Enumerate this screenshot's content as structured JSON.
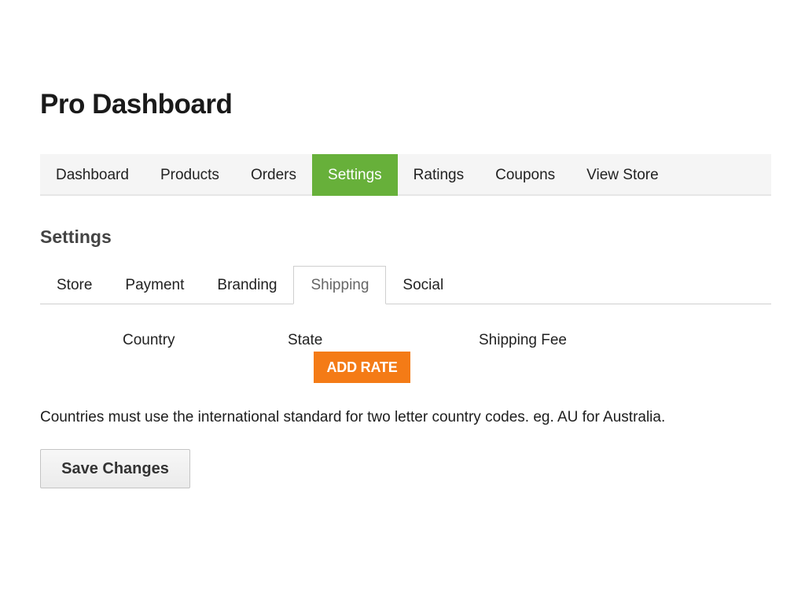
{
  "page": {
    "title": "Pro Dashboard"
  },
  "main_nav": {
    "items": [
      {
        "label": "Dashboard",
        "active": false
      },
      {
        "label": "Products",
        "active": false
      },
      {
        "label": "Orders",
        "active": false
      },
      {
        "label": "Settings",
        "active": true
      },
      {
        "label": "Ratings",
        "active": false
      },
      {
        "label": "Coupons",
        "active": false
      },
      {
        "label": "View Store",
        "active": false
      }
    ]
  },
  "settings": {
    "title": "Settings",
    "tabs": [
      {
        "label": "Store",
        "active": false
      },
      {
        "label": "Payment",
        "active": false
      },
      {
        "label": "Branding",
        "active": false
      },
      {
        "label": "Shipping",
        "active": true
      },
      {
        "label": "Social",
        "active": false
      }
    ]
  },
  "shipping": {
    "columns": {
      "country": "Country",
      "state": "State",
      "fee": "Shipping Fee"
    },
    "add_rate_label": "ADD RATE",
    "help_text": "Countries must use the international standard for two letter country codes. eg. AU for Australia."
  },
  "actions": {
    "save_label": "Save Changes"
  },
  "colors": {
    "active_nav": "#67b03a",
    "add_rate": "#f47b16",
    "nav_background": "#f5f5f5"
  }
}
